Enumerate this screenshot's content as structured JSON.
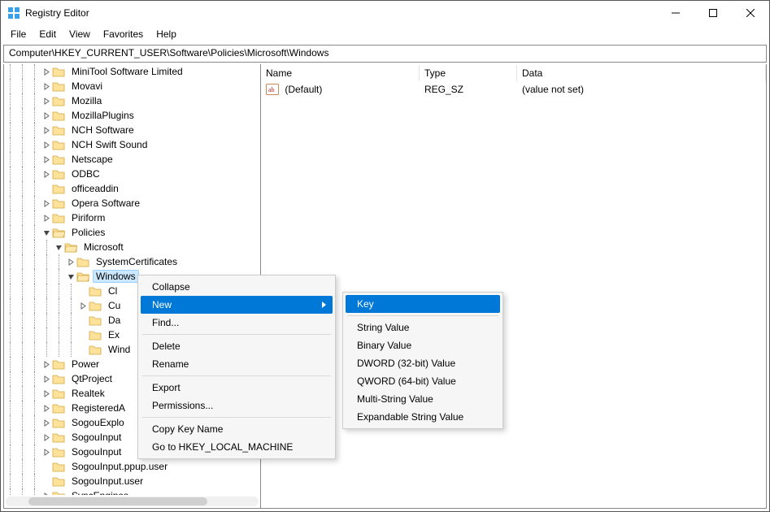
{
  "window": {
    "title": "Registry Editor"
  },
  "menu": {
    "file": "File",
    "edit": "Edit",
    "view": "View",
    "favorites": "Favorites",
    "help": "Help"
  },
  "address": "Computer\\HKEY_CURRENT_USER\\Software\\Policies\\Microsoft\\Windows",
  "tree": {
    "items": [
      {
        "depth": 3,
        "exp": ">",
        "label": "MiniTool Software Limited"
      },
      {
        "depth": 3,
        "exp": ">",
        "label": "Movavi"
      },
      {
        "depth": 3,
        "exp": ">",
        "label": "Mozilla"
      },
      {
        "depth": 3,
        "exp": ">",
        "label": "MozillaPlugins"
      },
      {
        "depth": 3,
        "exp": ">",
        "label": "NCH Software"
      },
      {
        "depth": 3,
        "exp": ">",
        "label": "NCH Swift Sound"
      },
      {
        "depth": 3,
        "exp": ">",
        "label": "Netscape"
      },
      {
        "depth": 3,
        "exp": ">",
        "label": "ODBC"
      },
      {
        "depth": 3,
        "exp": "",
        "label": "officeaddin"
      },
      {
        "depth": 3,
        "exp": ">",
        "label": "Opera Software"
      },
      {
        "depth": 3,
        "exp": ">",
        "label": "Piriform"
      },
      {
        "depth": 3,
        "exp": "v",
        "label": "Policies",
        "open": true
      },
      {
        "depth": 4,
        "exp": "v",
        "label": "Microsoft",
        "open": true
      },
      {
        "depth": 5,
        "exp": ">",
        "label": "SystemCertificates"
      },
      {
        "depth": 5,
        "exp": "v",
        "label": "Windows",
        "open": true,
        "selected": true
      },
      {
        "depth": 6,
        "exp": "",
        "label": "Cl"
      },
      {
        "depth": 6,
        "exp": ">",
        "label": "Cu"
      },
      {
        "depth": 6,
        "exp": "",
        "label": "Da"
      },
      {
        "depth": 6,
        "exp": "",
        "label": "Ex"
      },
      {
        "depth": 6,
        "exp": "",
        "label": "Wind"
      },
      {
        "depth": 3,
        "exp": ">",
        "label": "Power"
      },
      {
        "depth": 3,
        "exp": ">",
        "label": "QtProject"
      },
      {
        "depth": 3,
        "exp": ">",
        "label": "Realtek"
      },
      {
        "depth": 3,
        "exp": ">",
        "label": "RegisteredA"
      },
      {
        "depth": 3,
        "exp": ">",
        "label": "SogouExplo"
      },
      {
        "depth": 3,
        "exp": ">",
        "label": "SogouInput"
      },
      {
        "depth": 3,
        "exp": ">",
        "label": "SogouInput"
      },
      {
        "depth": 3,
        "exp": "",
        "label": "SogouInput.ppup.user"
      },
      {
        "depth": 3,
        "exp": "",
        "label": "SogouInput.user"
      },
      {
        "depth": 3,
        "exp": ">",
        "label": "SyncEngines"
      }
    ]
  },
  "list": {
    "cols": {
      "name": "Name",
      "type": "Type",
      "data": "Data"
    },
    "rows": [
      {
        "name": "(Default)",
        "type": "REG_SZ",
        "data": "(value not set)"
      }
    ]
  },
  "ctx1": {
    "collapse": "Collapse",
    "new": "New",
    "find": "Find...",
    "delete": "Delete",
    "rename": "Rename",
    "export": "Export",
    "permissions": "Permissions...",
    "copykey": "Copy Key Name",
    "goto": "Go to HKEY_LOCAL_MACHINE"
  },
  "ctx2": {
    "key": "Key",
    "string": "String Value",
    "binary": "Binary Value",
    "dword": "DWORD (32-bit) Value",
    "qword": "QWORD (64-bit) Value",
    "multi": "Multi-String Value",
    "exp": "Expandable String Value"
  }
}
